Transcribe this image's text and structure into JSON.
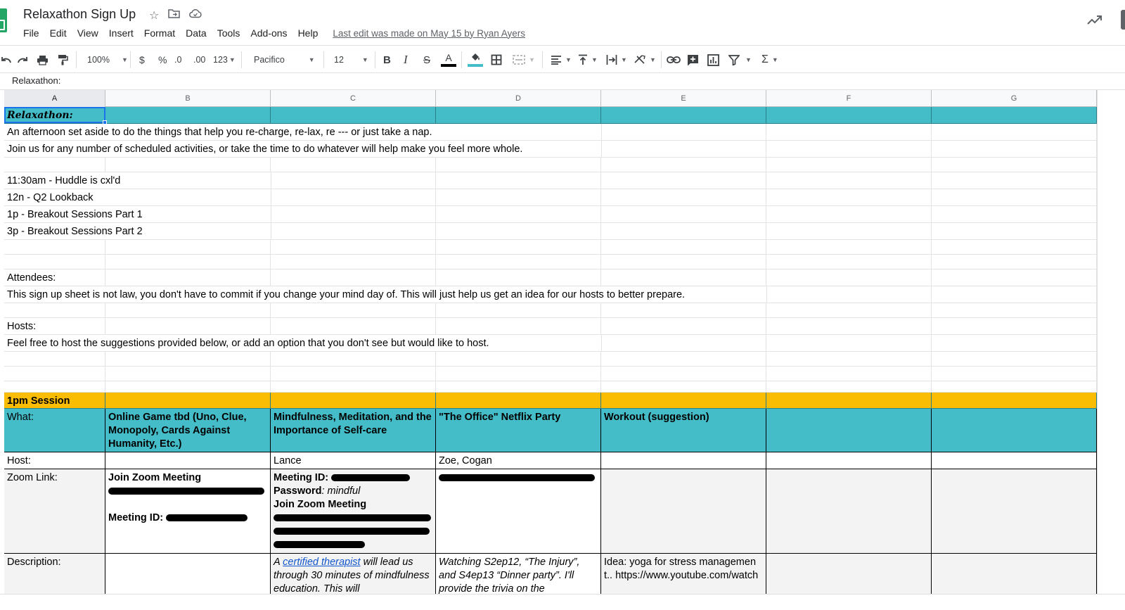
{
  "header": {
    "title": "Relaxathon Sign Up",
    "menu": [
      "File",
      "Edit",
      "View",
      "Insert",
      "Format",
      "Data",
      "Tools",
      "Add-ons",
      "Help"
    ],
    "last_edit": "Last edit was made on May 15 by Ryan Ayers"
  },
  "toolbar": {
    "zoom": "100%",
    "currency": "$",
    "percent": "%",
    "dec_decrease": ".0",
    "dec_increase": ".00",
    "format_more": "123",
    "font": "Pacifico",
    "font_size": "12",
    "bold": "B",
    "italic": "I",
    "strike": "S",
    "text_color": "A",
    "sum": "Σ"
  },
  "formula": {
    "value": "Relaxathon:"
  },
  "columns": [
    "A",
    "B",
    "C",
    "D",
    "E",
    "F",
    "G"
  ],
  "rows": {
    "r1": "Relaxathon:",
    "r2": "An afternoon set aside to do the things that help you re-charge, re-lax, re --- or just take a nap.",
    "r3": "Join us for any number of scheduled activities, or take the time to do whatever will help make you feel more whole.",
    "r5": "11:30am - Huddle is cxl'd",
    "r6": "12n - Q2 Lookback",
    "r7": "1p - Breakout Sessions Part 1",
    "r8": "3p - Breakout Sessions Part 2",
    "r11": "Attendees:",
    "r12": "This sign up sheet is not law, you don't have to commit if you change your mind  day of. This will just help us get an idea for our hosts to better prepare.",
    "r14": "Hosts:",
    "r15": "Feel free to host the suggestions provided below, or add an option that you don't see but would like to host."
  },
  "session": {
    "title": "1pm Session",
    "what_label": "What:",
    "what": [
      "Online Game tbd (Uno, Clue, Monopoly, Cards Against Humanity, Etc.)",
      "Mindfulness, Meditation, and the Importance of Self-care",
      "\"The Office\" Netflix Party",
      "Workout (suggestion)"
    ],
    "host_label": "Host:",
    "hosts": [
      "",
      "Lance",
      "Zoe, Cogan",
      ""
    ],
    "zoom_label": "Zoom Link:",
    "zoom_b_title": "Join Zoom Meeting",
    "zoom_b_meeting": "Meeting ID:",
    "zoom_c_meeting": "Meeting ID:",
    "zoom_c_password_label": "Password",
    "zoom_c_password": ": mindful",
    "zoom_c_join": "Join Zoom Meeting",
    "desc_label": "Description:",
    "desc_c_pre": "A ",
    "desc_c_link": "certified therapist",
    "desc_c_post": " will lead us through 30 minutes of mindfulness education. This will",
    "desc_d": "Watching S2ep12, “The Injury”, and S4ep13 “Dinner party”. I'll provide the trivia on the",
    "desc_e": "Idea: yoga for stress management.. https://www.youtube.com/watch"
  },
  "colors": {
    "teal": "#45bdc9",
    "gold": "#fbbc04",
    "selection": "#1a73e8",
    "link": "#1155cc"
  }
}
